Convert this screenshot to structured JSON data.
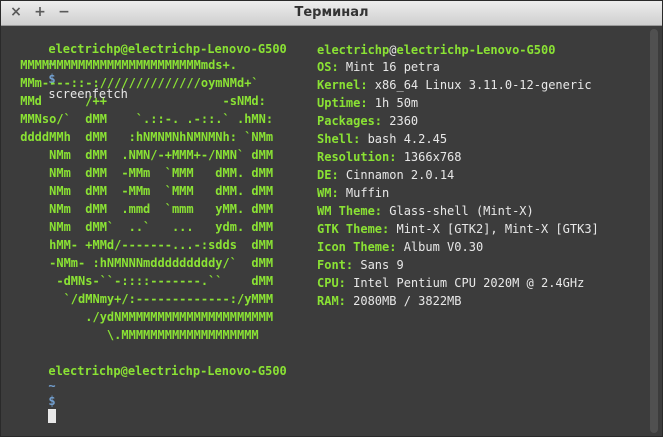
{
  "window": {
    "title": "Терминал",
    "close_glyph": "×",
    "maximize_glyph": "+",
    "minimize_glyph": "−"
  },
  "prompt": {
    "user_host": "electrichp@electrichp-Lenovo-G500",
    "tilde": "~",
    "dollar": "$",
    "command": "screenfetch"
  },
  "art": [
    " MMMMMMMMMMMMMMMMMMMMMMMMMmds+.",
    " MMm----::-://////////////oymNMd+`",
    " MMd      /++                -sNMd:",
    " MMNso/`  dMM    `.::-. .-::.` .hMN:",
    " ddddMMh  dMM   :hNMNMNhNMNMNh: `NMm",
    "     NMm  dMM  .NMN/-+MMM+-/NMN` dMM",
    "     NMm  dMM  -MMm  `MMM   dMM. dMM",
    "     NMm  dMM  -MMm  `MMM   dMM. dMM",
    "     NMm  dMM  .mmd  `mmm   yMM. dMM",
    "     NMm  dMM`  ..`   ...   ydm. dMM",
    "     hMM- +MMd/-------...-:sdds  dMM",
    "     -NMm- :hNMNNNmdddddddddy/`  dMM",
    "      -dMNs-``-::::-------.``    dMM",
    "       `/dMNmy+/:-------------:/yMMM",
    "          ./ydNMMMMMMMMMMMMMMMMMMMMM",
    "             \\.MMMMMMMMMMMMMMMMMMM"
  ],
  "sysinfo": {
    "user": "electrichp",
    "at": "@",
    "host": "electrichp-Lenovo-G500",
    "rows": [
      {
        "key": "OS:",
        "value": " Mint 16 petra"
      },
      {
        "key": "Kernel:",
        "value": " x86_64 Linux 3.11.0-12-generic"
      },
      {
        "key": "Uptime:",
        "value": " 1h 50m"
      },
      {
        "key": "Packages:",
        "value": " 2360"
      },
      {
        "key": "Shell:",
        "value": " bash 4.2.45"
      },
      {
        "key": "Resolution:",
        "value": " 1366x768"
      },
      {
        "key": "DE:",
        "value": " Cinnamon 2.0.14"
      },
      {
        "key": "WM:",
        "value": " Muffin"
      },
      {
        "key": "WM Theme:",
        "value": " Glass-shell (Mint-X)"
      },
      {
        "key": "GTK Theme:",
        "value": " Mint-X [GTK2], Mint-X [GTK3]"
      },
      {
        "key": "Icon Theme:",
        "value": " Album V0.30"
      },
      {
        "key": "Font:",
        "value": " Sans 9"
      },
      {
        "key": "CPU:",
        "value": " Intel Pentium CPU 2020M @ 2.4GHz"
      },
      {
        "key": "RAM:",
        "value": " 2080MB / 3822MB"
      }
    ]
  },
  "colors": {
    "green": "#8ae234",
    "blue": "#729fcf",
    "text": "#e8e8e8",
    "background": "#3c3c3c"
  }
}
